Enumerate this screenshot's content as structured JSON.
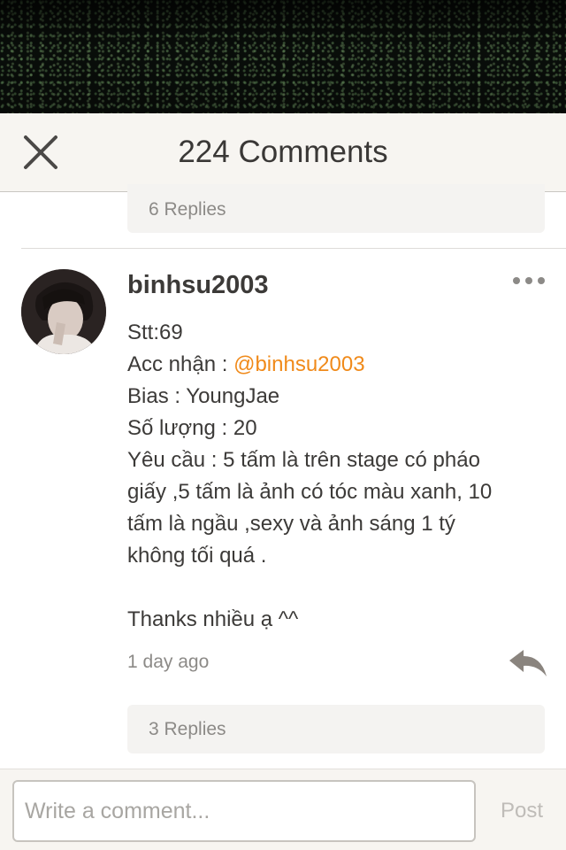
{
  "header": {
    "title": "224 Comments",
    "close_icon": "close-icon"
  },
  "previous_comment": {
    "replies_label": "6 Replies"
  },
  "comment": {
    "username": "binhsu2003",
    "lines": {
      "stt": "Stt:69",
      "acc_prefix": "Acc nhận : ",
      "acc_mention": "@binhsu2003",
      "bias": "Bias : YoungJae",
      "quantity": "Số lượng : 20",
      "request_1": "Yêu cầu : 5 tấm là trên stage có pháo",
      "request_2": "giấy ,5 tấm là ảnh có tóc màu xanh, 10",
      "request_3": "tấm là ngầu ,sexy và ảnh sáng 1 tý",
      "request_4": "không tối quá ."
    },
    "thanks": "Thanks nhiều ạ ^^",
    "timestamp": "1 day ago",
    "replies_label": "3 Replies",
    "mention_color": "#f08a1a",
    "more_icon": "more-options-icon",
    "reply_icon": "reply-arrow-icon"
  },
  "composer": {
    "placeholder": "Write a comment...",
    "value": "",
    "post_label": "Post"
  }
}
